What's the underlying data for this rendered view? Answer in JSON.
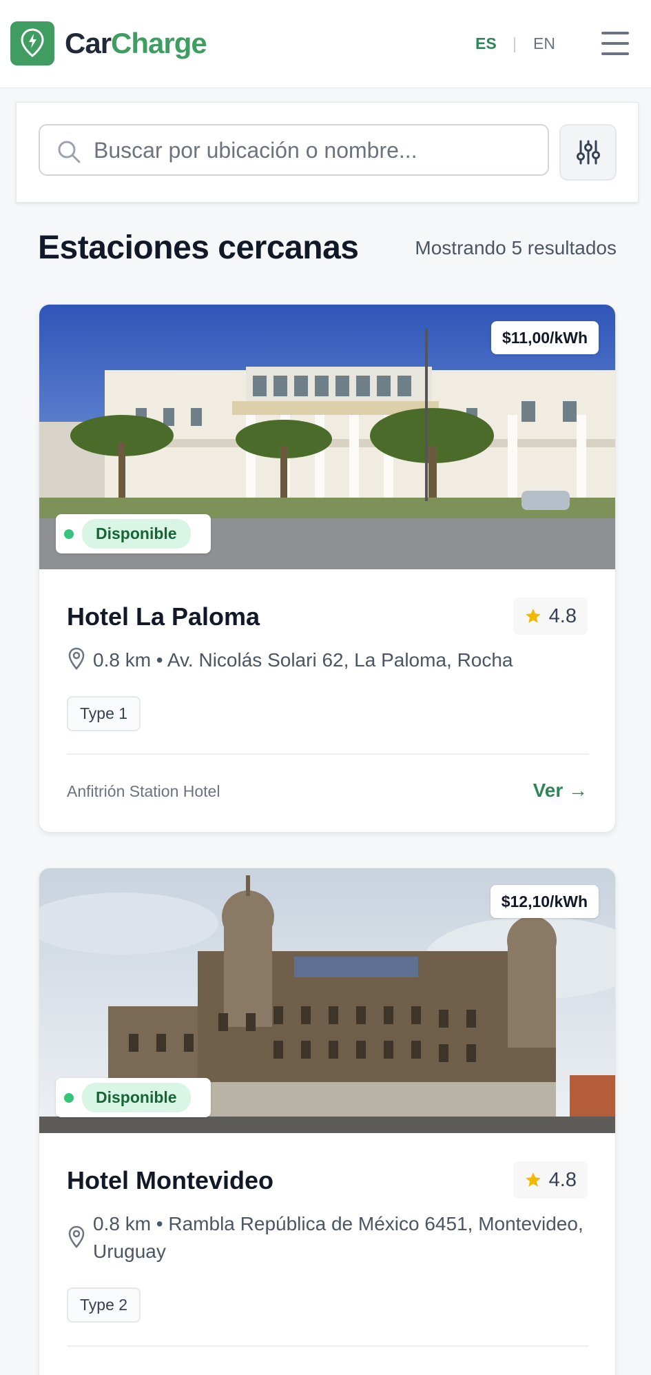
{
  "header": {
    "brand_part1": "Car",
    "brand_part2": "Charge",
    "lang_es": "ES",
    "lang_separator": "|",
    "lang_en": "EN",
    "menu_icon": "hamburger-menu-icon",
    "logo_icon": "charging-pin-icon"
  },
  "search": {
    "placeholder": "Buscar por ubicación o nombre...",
    "value": "",
    "icon": "search-icon",
    "filter_icon": "sliders-icon"
  },
  "section": {
    "title": "Estaciones cercanas",
    "result_count": "Mostrando 5 resultados"
  },
  "stations": [
    {
      "price": "$11,00/kWh",
      "status": "Disponible",
      "name": "Hotel La Paloma",
      "rating": "4.8",
      "address": "0.8 km • Av. Nicolás Solari 62, La Paloma, Rocha",
      "connector": "Type 1",
      "host": "Anfitrión Station Hotel",
      "view_label": "Ver →"
    },
    {
      "price": "$12,10/kWh",
      "status": "Disponible",
      "name": "Hotel Montevideo",
      "rating": "4.8",
      "address": "0.8 km • Rambla República de México 6451, Montevideo, Uruguay",
      "connector": "Type 2"
    }
  ],
  "colors": {
    "brand_green": "#3f9d62",
    "status_dot": "#34c57a",
    "status_pill_bg": "#d9f5e5",
    "star": "#f5b800"
  }
}
